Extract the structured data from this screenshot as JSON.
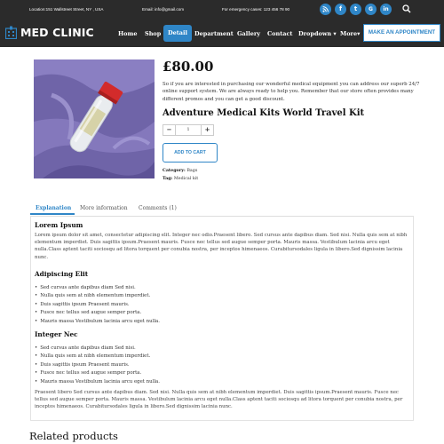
{
  "topbar": {
    "location": "Location:151 Wallstreet Street, NY , USA",
    "email": "Email: info@gmail.com",
    "emergency": "For emergency cases: 123 456 78 90",
    "social": [
      "rss-icon",
      "facebook-icon",
      "twitter-icon",
      "google-plus-icon",
      "linkedin-icon"
    ]
  },
  "brand": {
    "name": "MED CLINIC",
    "color": "#2f86c7"
  },
  "nav": {
    "items": [
      "Home",
      "Shop",
      "Detail",
      "Department",
      "Gallery",
      "Contact",
      "Dropdown",
      "More"
    ],
    "active": "Detail",
    "appointment": "MAKE AN APPOINTMENT"
  },
  "product": {
    "price": "£80.00",
    "description": "So if you are interested in purchasing our wonderful medical equipment you can address our superb 24/7 online support system. We are always ready to help you. Remember that our store often provides many different promos and you can get a good discount.",
    "title": "Adventure Medical Kits World Travel Kit",
    "quantity": "1",
    "add_to_cart": "ADD TO CART",
    "category_label": "Category:",
    "category": "Bags",
    "tag_label": "Tag:",
    "tag": "Medical kit"
  },
  "tabs": [
    "Explanation",
    "More information",
    "Comments (1)"
  ],
  "explanation": {
    "h1": "Lorem Ipsum",
    "p1": "Lorem ipsum dolor sit amet, consectetur adipiscing elit. Integer nec odio.Praesent libero. Sed cursus ante dapibus diam. Sed nisi. Nulla quis sem at nibh elementum imperdiet. Duis sagittis ipsum.Praesent mauris. Fusce nec tellus sed augue semper porta. Mauris massa. Vestibulum lacinia arcu eget nulla.Class aptent taciti sociosqu ad litora torquent per conubia nostra, per inceptos himenaeos. Curabitursodales ligula in libero.Sed dignissim lacinia nunc.",
    "h2": "Adipiscing Elit",
    "list1": [
      "Sed cursus ante dapibus diam Sed nisi.",
      "Nulla quis sem at nibh elementum imperdiet.",
      "Duis sagittis ipsum Praesent mauris.",
      "Fusce nec tellus sed augue semper porta.",
      "Mauris massa Vestibulum lacinia arcu eget nulla."
    ],
    "h3": "Integer Nec",
    "list2": [
      "Sed cursus ante dapibus diam Sed nisi.",
      "Nulla quis sem at nibh elementum imperdiet.",
      "Duis sagittis ipsum Praesent mauris.",
      "Fusce nec tellus sed augue semper porta.",
      "Mauris massa Vestibulum lacinia arcu eget nulla."
    ],
    "p2": "Praesent libero Sed cursus ante dapibus diam. Sed nisi. Nulla quis sem at nibh elementum imperdiet. Duis sagittis ipsum.Praesent mauris. Fusce nec tellus sed augue semper porta. Mauris massa. Vestibulum lacinia arcu eget nulla.Class aptent taciti sociosqu ad litora torquent per conubia nostra, per inceptos himenaeos. Curabitursodales ligula in libero.Sed dignissim lacinia nunc."
  },
  "related_heading": "Related products"
}
